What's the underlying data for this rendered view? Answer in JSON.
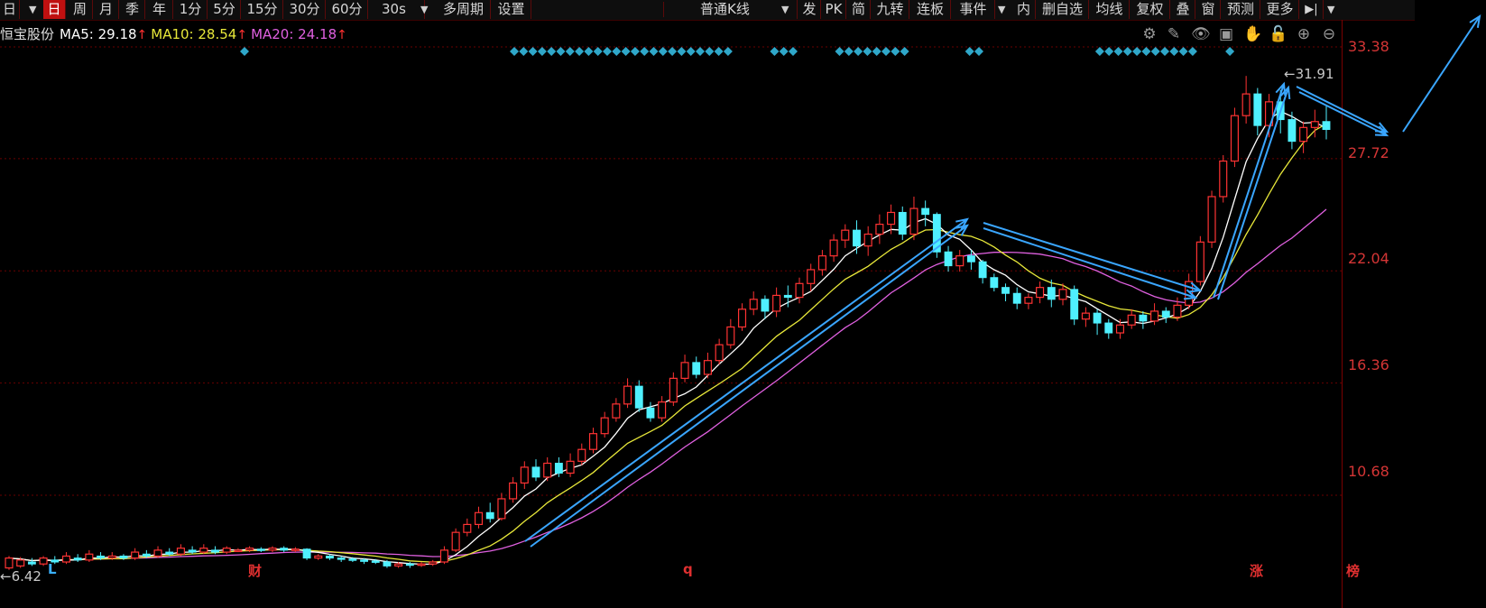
{
  "toolbar": {
    "left_items": [
      "日",
      "日",
      "周",
      "月",
      "季",
      "年",
      "1分",
      "5分",
      "15分",
      "30分",
      "60分",
      "30s",
      "多周期",
      "设置"
    ],
    "right_items": [
      "普通K线",
      "发",
      "PK",
      "简",
      "九转",
      "连板",
      "事件",
      "内",
      "删自选",
      "均线",
      "复权",
      "叠",
      "窗",
      "预测",
      "更多"
    ]
  },
  "stock": {
    "name": "恒宝股份",
    "ma5_label": "MA5: 29.18",
    "ma10_label": "MA10: 28.54",
    "ma20_label": "MA20: 24.18",
    "arrow": "↑"
  },
  "colors": {
    "up": "#ff3333",
    "down": "#4ff0ff",
    "ma5": "#ffffff",
    "ma10": "#e8e83a",
    "ma20": "#e060e0",
    "trend": "#3aa6ff",
    "grid": "#6a0000",
    "marker": "#2fa7c9"
  },
  "tool_icons": [
    "gear-icon",
    "pen-icon",
    "eye-icon",
    "lock-box-icon",
    "hand-icon",
    "lock-icon",
    "zoom-in-icon",
    "zoom-out-icon"
  ],
  "chart_data": {
    "type": "candlestick",
    "y_ticks": [
      33.38,
      27.72,
      22.04,
      16.36,
      10.68
    ],
    "y_tick_labels": [
      "33.38",
      "27.72",
      "22.04",
      "16.36",
      "10.68"
    ],
    "max_label": "31.91",
    "min_label": "6.42",
    "event_flags": [
      "L",
      "财",
      "q",
      "涨",
      "榜"
    ],
    "candles": [
      [
        7.0,
        7.5,
        6.9,
        7.6
      ],
      [
        7.1,
        7.4,
        7.0,
        7.55
      ],
      [
        7.3,
        7.2,
        7.1,
        7.5
      ],
      [
        7.2,
        7.5,
        7.1,
        7.6
      ],
      [
        7.4,
        7.3,
        7.2,
        7.6
      ],
      [
        7.3,
        7.6,
        7.2,
        7.8
      ],
      [
        7.5,
        7.4,
        7.3,
        7.7
      ],
      [
        7.4,
        7.7,
        7.3,
        7.9
      ],
      [
        7.6,
        7.5,
        7.4,
        7.8
      ],
      [
        7.5,
        7.6,
        7.4,
        7.8
      ],
      [
        7.6,
        7.5,
        7.4,
        7.7
      ],
      [
        7.5,
        7.8,
        7.4,
        8.0
      ],
      [
        7.7,
        7.6,
        7.5,
        7.9
      ],
      [
        7.6,
        7.9,
        7.5,
        8.1
      ],
      [
        7.8,
        7.7,
        7.6,
        8.0
      ],
      [
        7.7,
        8.0,
        7.6,
        8.2
      ],
      [
        7.9,
        7.8,
        7.7,
        8.1
      ],
      [
        7.8,
        8.0,
        7.7,
        8.2
      ],
      [
        7.9,
        7.8,
        7.7,
        8.1
      ],
      [
        7.8,
        8.0,
        7.7,
        8.1
      ],
      [
        7.9,
        7.9,
        7.8,
        8.0
      ],
      [
        7.9,
        8.0,
        7.8,
        8.1
      ],
      [
        7.95,
        7.9,
        7.8,
        8.05
      ],
      [
        7.9,
        8.0,
        7.8,
        8.1
      ],
      [
        8.0,
        7.9,
        7.8,
        8.1
      ],
      [
        7.9,
        7.95,
        7.8,
        8.05
      ],
      [
        7.95,
        7.5,
        7.4,
        8.0
      ],
      [
        7.5,
        7.6,
        7.4,
        7.7
      ],
      [
        7.6,
        7.5,
        7.4,
        7.7
      ],
      [
        7.5,
        7.45,
        7.3,
        7.6
      ],
      [
        7.45,
        7.4,
        7.3,
        7.55
      ],
      [
        7.4,
        7.35,
        7.2,
        7.5
      ],
      [
        7.35,
        7.3,
        7.2,
        7.45
      ],
      [
        7.3,
        7.1,
        7.0,
        7.4
      ],
      [
        7.1,
        7.2,
        7.0,
        7.3
      ],
      [
        7.2,
        7.15,
        7.0,
        7.3
      ],
      [
        7.15,
        7.2,
        7.05,
        7.3
      ],
      [
        7.2,
        7.3,
        7.1,
        7.4
      ],
      [
        7.3,
        7.9,
        7.2,
        8.1
      ],
      [
        7.9,
        8.8,
        7.8,
        9.0
      ],
      [
        8.8,
        9.2,
        8.6,
        9.5
      ],
      [
        9.2,
        9.8,
        9.0,
        10.1
      ],
      [
        9.8,
        9.5,
        9.3,
        10.3
      ],
      [
        9.5,
        10.5,
        9.4,
        10.8
      ],
      [
        10.5,
        11.3,
        10.3,
        11.6
      ],
      [
        11.3,
        12.1,
        11.0,
        12.4
      ],
      [
        12.1,
        11.6,
        11.4,
        12.5
      ],
      [
        11.6,
        12.3,
        11.4,
        12.6
      ],
      [
        12.3,
        11.8,
        11.6,
        12.6
      ],
      [
        11.8,
        12.4,
        11.6,
        12.8
      ],
      [
        12.4,
        13.0,
        12.2,
        13.3
      ],
      [
        13.0,
        13.8,
        12.8,
        14.1
      ],
      [
        13.8,
        14.6,
        13.6,
        14.9
      ],
      [
        14.6,
        15.3,
        14.4,
        15.6
      ],
      [
        15.3,
        16.2,
        15.1,
        16.6
      ],
      [
        16.2,
        15.1,
        14.9,
        16.5
      ],
      [
        15.1,
        14.6,
        14.4,
        15.4
      ],
      [
        14.6,
        15.4,
        14.4,
        15.7
      ],
      [
        15.4,
        16.6,
        15.2,
        16.9
      ],
      [
        16.6,
        17.4,
        16.4,
        17.8
      ],
      [
        17.4,
        16.8,
        16.6,
        17.7
      ],
      [
        16.8,
        17.5,
        16.6,
        17.9
      ],
      [
        17.5,
        18.3,
        17.3,
        18.6
      ],
      [
        18.3,
        19.2,
        18.1,
        19.6
      ],
      [
        19.2,
        20.1,
        19.0,
        20.4
      ],
      [
        20.1,
        20.6,
        19.8,
        21.0
      ],
      [
        20.6,
        20.0,
        19.6,
        20.8
      ],
      [
        20.0,
        20.8,
        19.7,
        21.2
      ],
      [
        20.8,
        20.7,
        20.2,
        21.3
      ],
      [
        20.7,
        21.4,
        20.4,
        21.7
      ],
      [
        21.4,
        22.1,
        21.0,
        22.4
      ],
      [
        22.1,
        22.8,
        21.8,
        23.1
      ],
      [
        22.8,
        23.6,
        22.5,
        23.9
      ],
      [
        23.6,
        24.1,
        23.2,
        24.4
      ],
      [
        24.1,
        23.3,
        22.9,
        24.6
      ],
      [
        23.3,
        23.9,
        22.8,
        24.3
      ],
      [
        23.9,
        24.4,
        23.4,
        24.9
      ],
      [
        24.4,
        25.0,
        23.9,
        25.4
      ],
      [
        25.0,
        23.9,
        23.6,
        25.3
      ],
      [
        23.9,
        25.2,
        23.6,
        25.8
      ],
      [
        25.2,
        24.9,
        24.3,
        25.6
      ],
      [
        24.9,
        23.0,
        22.7,
        25.0
      ],
      [
        23.0,
        22.3,
        22.0,
        23.3
      ],
      [
        22.3,
        22.8,
        22.0,
        23.1
      ],
      [
        22.8,
        22.5,
        22.1,
        23.1
      ],
      [
        22.5,
        21.7,
        21.4,
        22.6
      ],
      [
        21.7,
        21.2,
        21.0,
        21.9
      ],
      [
        21.2,
        20.9,
        20.5,
        21.4
      ],
      [
        20.9,
        20.4,
        20.1,
        21.2
      ],
      [
        20.4,
        20.7,
        20.1,
        20.9
      ],
      [
        20.7,
        21.2,
        20.4,
        21.5
      ],
      [
        21.2,
        20.6,
        20.2,
        21.6
      ],
      [
        20.6,
        21.1,
        20.3,
        21.4
      ],
      [
        21.1,
        19.6,
        19.3,
        21.3
      ],
      [
        19.6,
        19.9,
        19.2,
        20.2
      ],
      [
        19.9,
        19.4,
        18.8,
        20.1
      ],
      [
        19.4,
        18.9,
        18.6,
        19.6
      ],
      [
        18.9,
        19.3,
        18.6,
        19.6
      ],
      [
        19.3,
        19.8,
        19.1,
        20.1
      ],
      [
        19.8,
        19.5,
        19.1,
        20.0
      ],
      [
        19.5,
        20.0,
        19.3,
        20.4
      ],
      [
        20.0,
        19.7,
        19.4,
        20.2
      ],
      [
        19.7,
        20.3,
        19.5,
        20.7
      ],
      [
        20.3,
        21.5,
        20.1,
        21.9
      ],
      [
        21.5,
        23.5,
        21.3,
        23.8
      ],
      [
        23.5,
        25.8,
        23.2,
        26.1
      ],
      [
        25.8,
        27.6,
        25.5,
        27.9
      ],
      [
        27.6,
        29.9,
        27.3,
        30.3
      ],
      [
        29.9,
        31.0,
        29.5,
        31.91
      ],
      [
        31.0,
        29.4,
        28.9,
        31.3
      ],
      [
        29.4,
        30.6,
        28.8,
        31.0
      ],
      [
        30.6,
        29.7,
        29.0,
        31.2
      ],
      [
        29.7,
        28.6,
        28.2,
        30.1
      ],
      [
        28.6,
        29.3,
        28.0,
        29.6
      ],
      [
        29.3,
        29.6,
        28.8,
        30.2
      ],
      [
        29.6,
        29.2,
        28.7,
        30.4
      ]
    ]
  }
}
